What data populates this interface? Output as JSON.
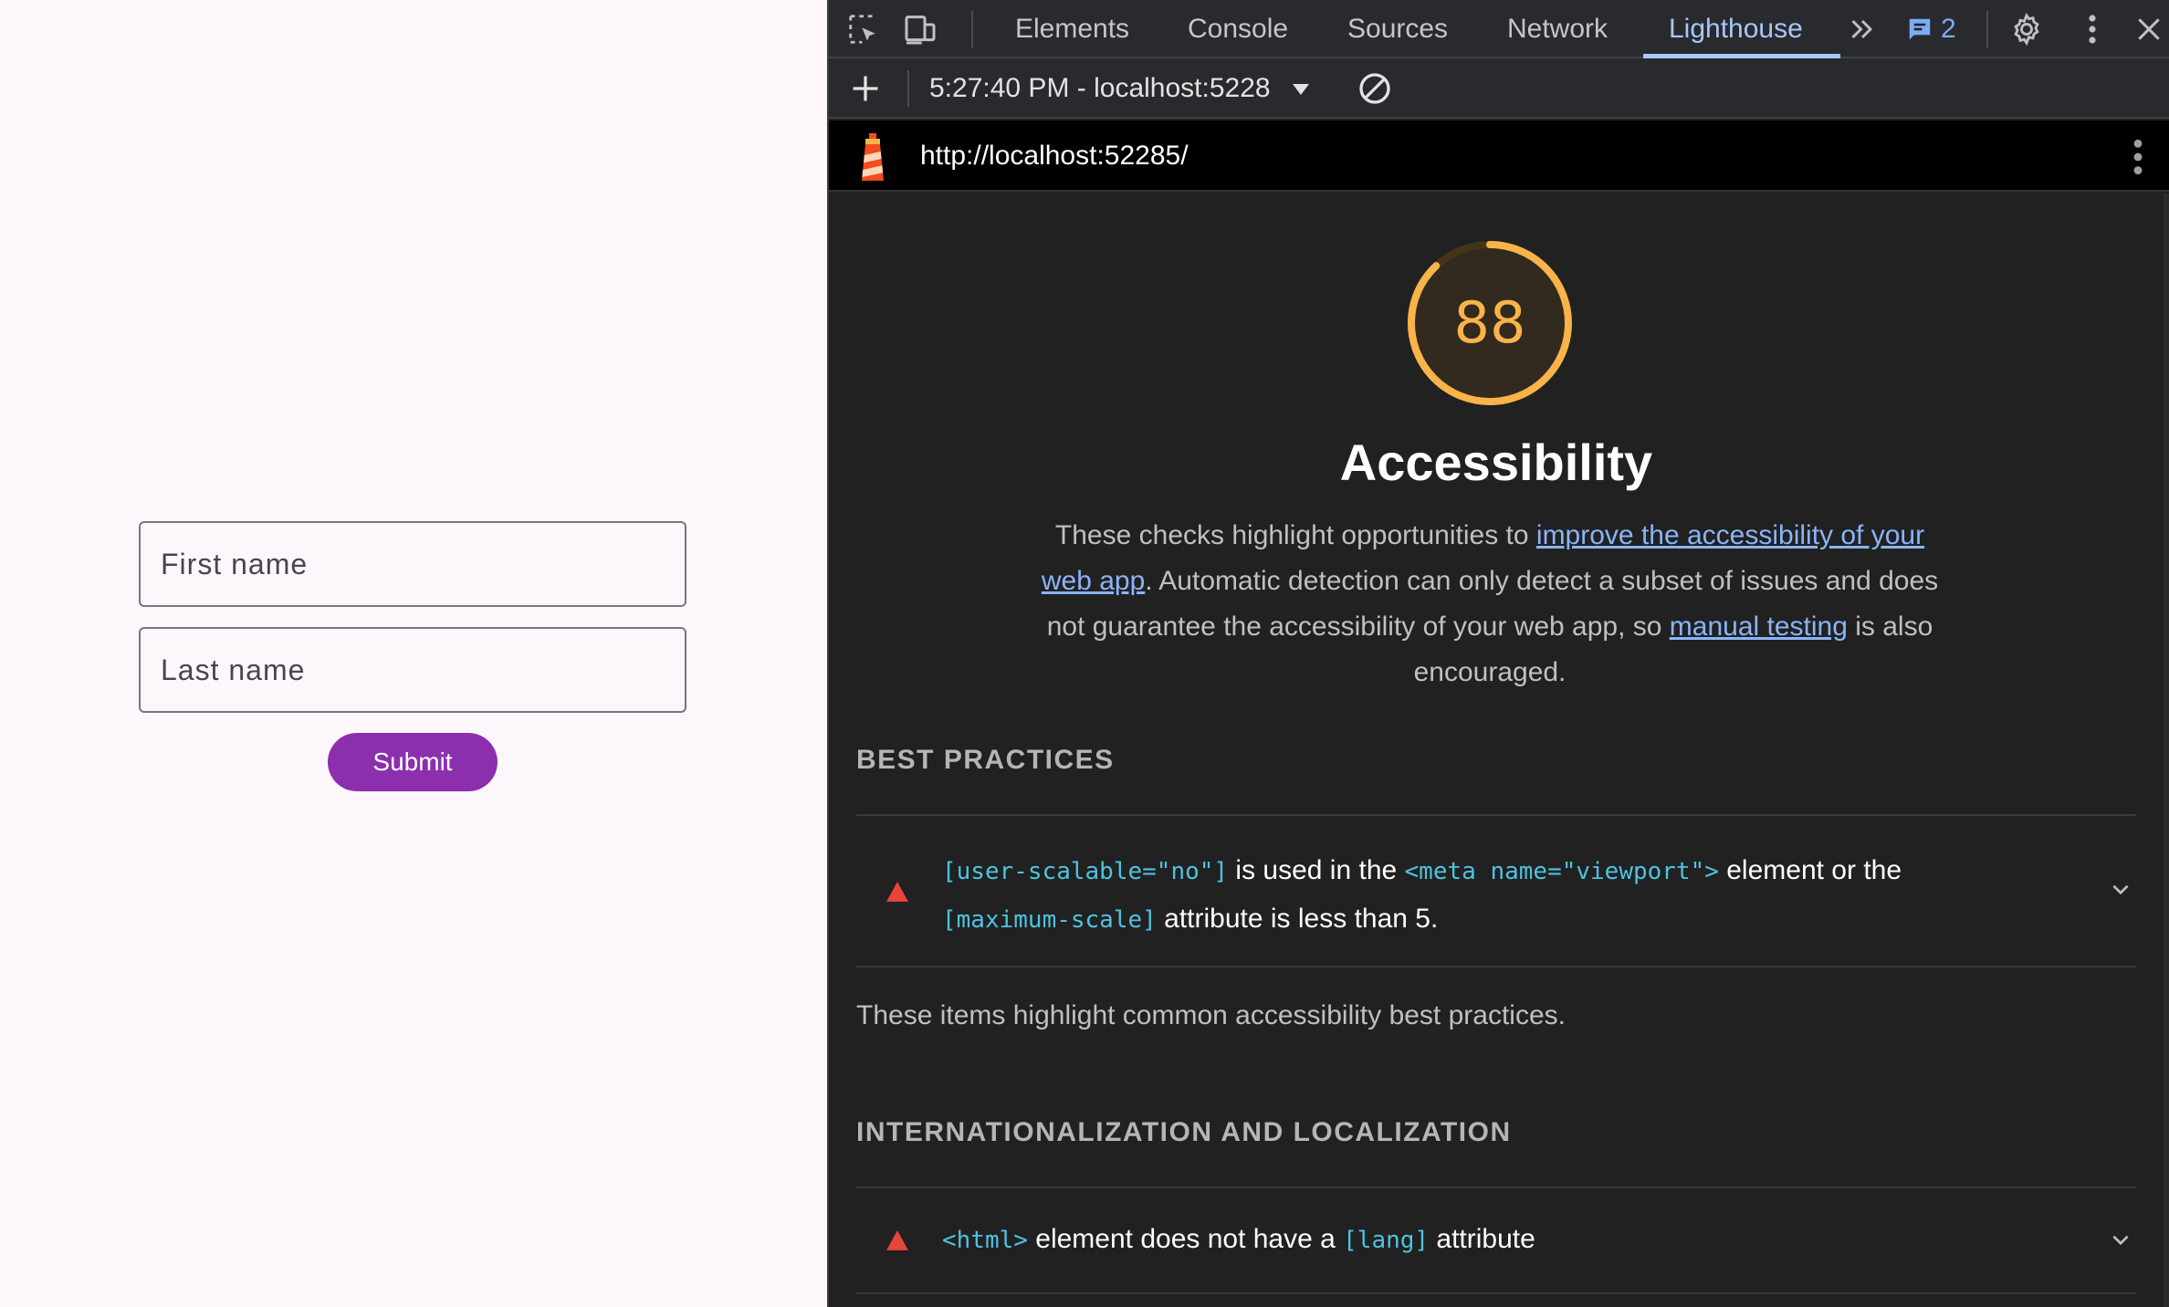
{
  "app": {
    "first_name_placeholder": "First name",
    "last_name_placeholder": "Last name",
    "submit_label": "Submit"
  },
  "devtools": {
    "tabs": [
      {
        "label": "Elements"
      },
      {
        "label": "Console"
      },
      {
        "label": "Sources"
      },
      {
        "label": "Network"
      },
      {
        "label": "Lighthouse"
      }
    ],
    "active_tab": "Lighthouse",
    "issues_count": "2",
    "report_selector": "5:27:40 PM - localhost:5228",
    "url": "http://localhost:52285/"
  },
  "report": {
    "score": "88",
    "score_fraction": 0.88,
    "score_color": "#f8b34a",
    "category_title": "Accessibility",
    "description": {
      "part1": "These checks highlight opportunities to ",
      "link1": "improve the accessibility of your web app",
      "part2": ". Automatic detection can only detect a subset of issues and does not guarantee the accessibility of your web app, so ",
      "link2": "manual testing",
      "part3": " is also encouraged."
    },
    "groups": [
      {
        "title": "BEST PRACTICES",
        "audit": {
          "code1": "[user-scalable=\"no\"]",
          "text1": " is used in the ",
          "code2": "<meta name=\"viewport\">",
          "text2": " element or the ",
          "code3": "[maximum-scale]",
          "text3": " attribute is less than 5."
        },
        "description": "These items highlight common accessibility best practices."
      },
      {
        "title": "INTERNATIONALIZATION AND LOCALIZATION",
        "audit": {
          "code1": "<html>",
          "text1": " element does not have a ",
          "code2": "[lang]",
          "text2": " attribute"
        }
      }
    ]
  }
}
